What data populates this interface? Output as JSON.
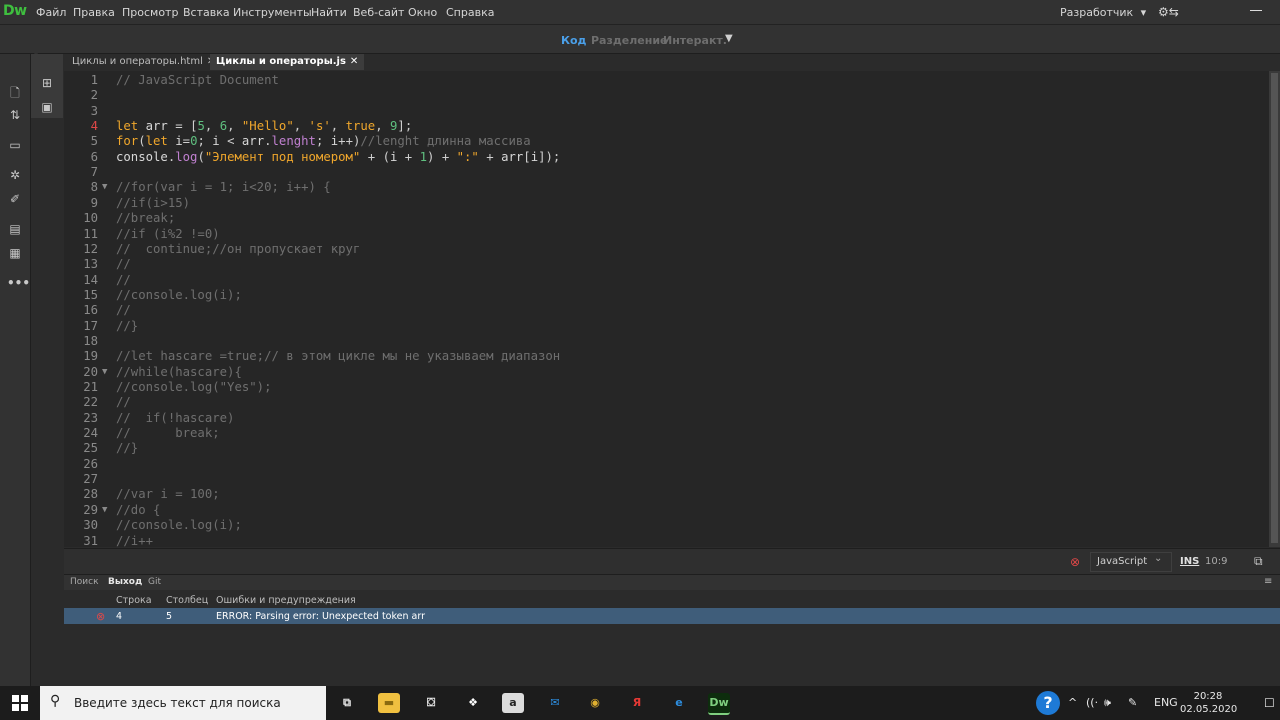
{
  "app": {
    "logo": "Dw",
    "menu": [
      "Файл",
      "Правка",
      "Просмотр",
      "Вставка",
      "Инструменты",
      "Найти",
      "Веб-сайт",
      "Окно",
      "Справка"
    ],
    "workspace": "Разработчик",
    "workspace_caret": "▾",
    "gear_icon": "⚙⇆"
  },
  "toolbar": {
    "view_code": "Код",
    "view_split": "Разделение",
    "view_live": "Интеракт.",
    "caret": "▼"
  },
  "tabs": [
    {
      "label": "Циклы и операторы.html",
      "close": "✕",
      "active": false
    },
    {
      "label": "Циклы и операторы.js",
      "close": "✕",
      "active": true
    }
  ],
  "editor": {
    "error_line": 4,
    "lines": [
      {
        "n": "1",
        "fold": "",
        "code": "// JavaScript Document"
      },
      {
        "n": "2",
        "fold": "",
        "code": ""
      },
      {
        "n": "3",
        "fold": "",
        "code": ""
      },
      {
        "n": "4",
        "fold": "",
        "code": "let arr = [5, 6, \"Hello\", 's', true, 9];"
      },
      {
        "n": "5",
        "fold": "",
        "code": "for(let i=0; i < arr.lenght; i++)//lenght длинна массива"
      },
      {
        "n": "6",
        "fold": "",
        "code": "console.log(\"Элемент под номером\" + (i + 1) + \":\" + arr[i]);"
      },
      {
        "n": "7",
        "fold": "",
        "code": ""
      },
      {
        "n": "8",
        "fold": "▼",
        "code": "//for(var i = 1; i<20; i++) {"
      },
      {
        "n": "9",
        "fold": "",
        "code": "//if(i>15)"
      },
      {
        "n": "10",
        "fold": "",
        "code": "//break;"
      },
      {
        "n": "11",
        "fold": "",
        "code": "//if (i%2 !=0)"
      },
      {
        "n": "12",
        "fold": "",
        "code": "//  continue;//он пропускает круг"
      },
      {
        "n": "13",
        "fold": "",
        "code": "//"
      },
      {
        "n": "14",
        "fold": "",
        "code": "//"
      },
      {
        "n": "15",
        "fold": "",
        "code": "//console.log(i);"
      },
      {
        "n": "16",
        "fold": "",
        "code": "//"
      },
      {
        "n": "17",
        "fold": "",
        "code": "//}"
      },
      {
        "n": "18",
        "fold": "",
        "code": ""
      },
      {
        "n": "19",
        "fold": "",
        "code": "//let hascare =true;// в этом цикле мы не указываем диапазон"
      },
      {
        "n": "20",
        "fold": "▼",
        "code": "//while(hascare){"
      },
      {
        "n": "21",
        "fold": "",
        "code": "//console.log(\"Yes\");"
      },
      {
        "n": "22",
        "fold": "",
        "code": "//"
      },
      {
        "n": "23",
        "fold": "",
        "code": "//  if(!hascare)"
      },
      {
        "n": "24",
        "fold": "",
        "code": "//      break;"
      },
      {
        "n": "25",
        "fold": "",
        "code": "//}"
      },
      {
        "n": "26",
        "fold": "",
        "code": ""
      },
      {
        "n": "27",
        "fold": "",
        "code": ""
      },
      {
        "n": "28",
        "fold": "",
        "code": "//var i = 100;"
      },
      {
        "n": "29",
        "fold": "▼",
        "code": "//do {"
      },
      {
        "n": "30",
        "fold": "",
        "code": "//console.log(i);"
      },
      {
        "n": "31",
        "fold": "",
        "code": "//i++"
      }
    ]
  },
  "status": {
    "error_icon": "⊗",
    "language": "JavaScript",
    "lang_caret": "⌄",
    "mode": "INS",
    "position": "10:9",
    "preview_icon": "⧉"
  },
  "panel": {
    "tabs": [
      "Поиск",
      "Выход",
      "Git"
    ],
    "menu_icon": "≡",
    "headers": {
      "line": "Строка",
      "column": "Столбец",
      "message": "Ошибки и предупреждения"
    },
    "rows": [
      {
        "icon": "⊗",
        "line": "4",
        "column": "5",
        "message": "ERROR: Parsing error: Unexpected token arr"
      }
    ]
  },
  "taskbar": {
    "search_placeholder": "Введите здесь текст для поиска",
    "search_icon": "⚲",
    "apps": [
      {
        "name": "task-view",
        "glyph": "⧉",
        "bg": "#1c1c1c",
        "fg": "#e8e8e8"
      },
      {
        "name": "explorer",
        "glyph": "▬",
        "bg": "#f0c040",
        "fg": "#8a6a10"
      },
      {
        "name": "store",
        "glyph": "⛋",
        "bg": "#1c1c1c",
        "fg": "#e8e8e8"
      },
      {
        "name": "dropbox",
        "glyph": "❖",
        "bg": "#1c1c1c",
        "fg": "#ffffff"
      },
      {
        "name": "amazon",
        "glyph": "a",
        "bg": "#dcdcdc",
        "fg": "#222222"
      },
      {
        "name": "mail",
        "glyph": "✉",
        "bg": "#1c1c1c",
        "fg": "#2d8ee0"
      },
      {
        "name": "chrome",
        "glyph": "◉",
        "bg": "#1c1c1c",
        "fg": "#e0b030"
      },
      {
        "name": "yandex",
        "glyph": "Я",
        "bg": "#1c1c1c",
        "fg": "#e53935"
      },
      {
        "name": "edge",
        "glyph": "e",
        "bg": "#1c1c1c",
        "fg": "#2d8ee0"
      },
      {
        "name": "dreamweaver",
        "glyph": "Dw",
        "bg": "#0d2d0d",
        "fg": "#7fd07f"
      }
    ],
    "help_glyph": "?",
    "tray_chevron": "^",
    "tray_net": "((·",
    "tray_vol": "🕪",
    "tray_pen": "✎",
    "lang": "ENG",
    "time": "20:28",
    "date": "02.05.2020",
    "notification_icon": "☐"
  }
}
